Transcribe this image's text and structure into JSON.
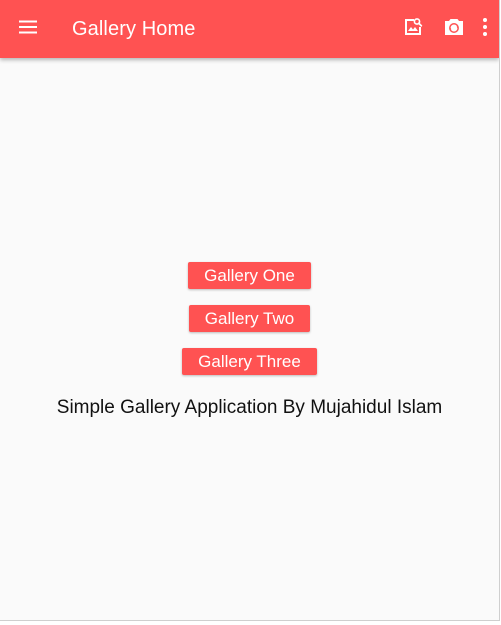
{
  "app_bar": {
    "title": "Gallery Home",
    "menu_icon": "menu-icon",
    "actions": [
      {
        "icon": "photo-search-icon"
      },
      {
        "icon": "camera-switch-icon"
      },
      {
        "icon": "more-vert-icon"
      }
    ]
  },
  "main": {
    "buttons": [
      {
        "label": "Gallery One"
      },
      {
        "label": "Gallery Two"
      },
      {
        "label": "Gallery Three"
      }
    ],
    "caption": "Simple Gallery Application By Mujahidul Islam"
  },
  "colors": {
    "accent": "#ff5252",
    "background": "#fafafa",
    "text": "#111111"
  }
}
